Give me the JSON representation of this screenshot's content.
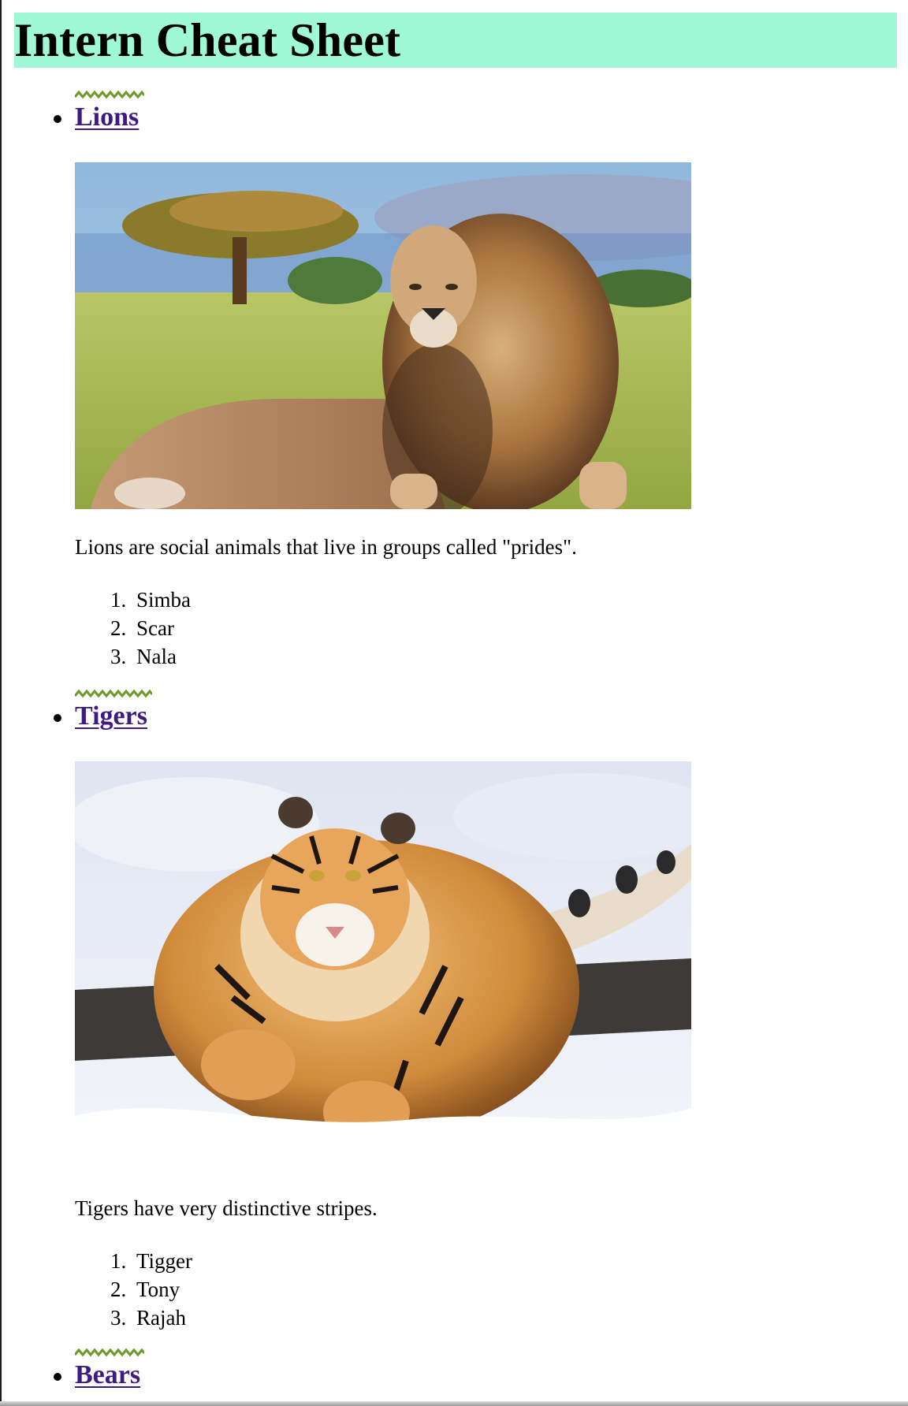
{
  "page": {
    "title": "Intern Cheat Sheet"
  },
  "colors": {
    "header_background": "#9ff9d6",
    "link": "#3f1a83",
    "squiggle": "#6f9a2a"
  },
  "animals": [
    {
      "name": "Lions",
      "image": "lion-photo",
      "fact": "Lions are social animals that live in groups called \"prides\".",
      "names": [
        {
          "number": "1.",
          "name": "Simba"
        },
        {
          "number": "2.",
          "name": "Scar"
        },
        {
          "number": "3.",
          "name": "Nala"
        }
      ]
    },
    {
      "name": "Tigers",
      "image": "tiger-photo",
      "fact": "Tigers have very distinctive stripes.",
      "names": [
        {
          "number": "1.",
          "name": "Tigger"
        },
        {
          "number": "2.",
          "name": "Tony"
        },
        {
          "number": "3.",
          "name": "Rajah"
        }
      ]
    },
    {
      "name": "Bears"
    }
  ]
}
